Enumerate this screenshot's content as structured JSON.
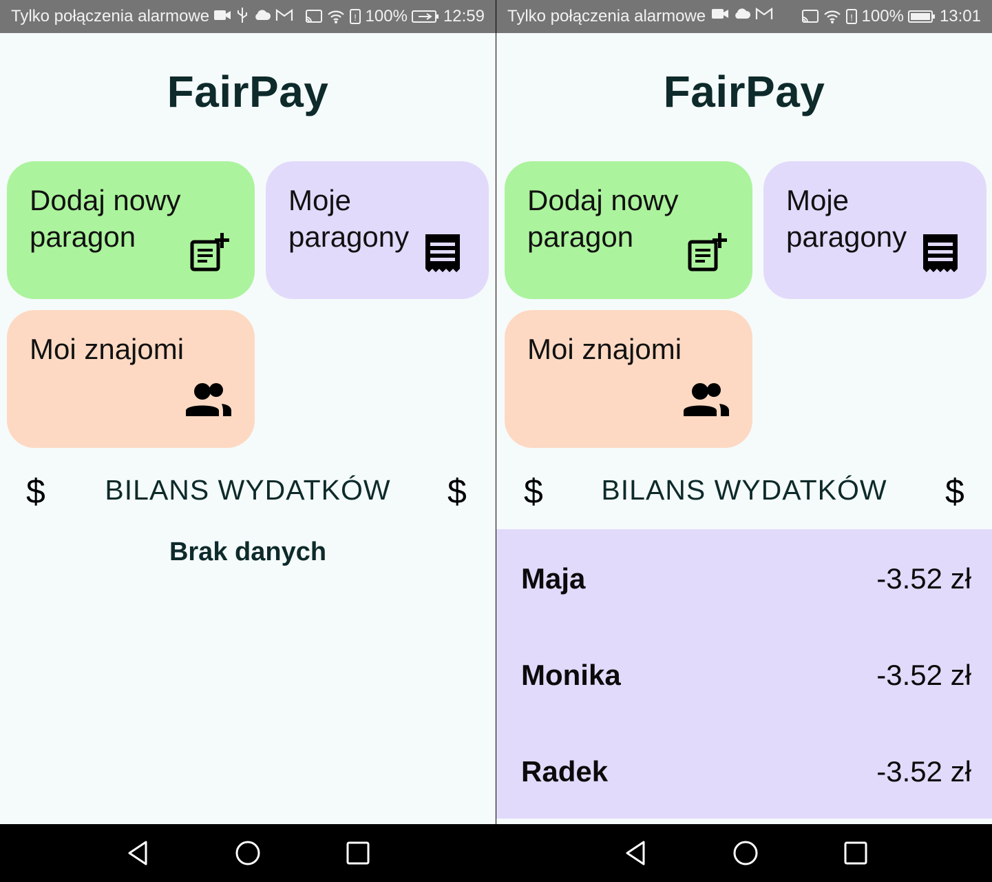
{
  "screens": [
    {
      "status": {
        "carrier": "Tylko połączenia alarmowe",
        "battery": "100%",
        "time": "12:59"
      },
      "app_title": "FairPay",
      "tiles": {
        "add_receipt": "Dodaj nowy paragon",
        "my_receipts": "Moje paragony",
        "my_friends": "Moi znajomi"
      },
      "balance": {
        "title": "BILANS WYDATKÓW",
        "currency_symbol": "$",
        "empty_text": "Brak danych"
      }
    },
    {
      "status": {
        "carrier": "Tylko połączenia alarmowe",
        "battery": "100%",
        "time": "13:01"
      },
      "app_title": "FairPay",
      "tiles": {
        "add_receipt": "Dodaj nowy paragon",
        "my_receipts": "Moje paragony",
        "my_friends": "Moi znajomi"
      },
      "balance": {
        "title": "BILANS WYDATKÓW",
        "currency_symbol": "$",
        "entries": [
          {
            "name": "Maja",
            "amount": "-3.52 zł"
          },
          {
            "name": "Monika",
            "amount": "-3.52 zł"
          },
          {
            "name": "Radek",
            "amount": "-3.52 zł"
          }
        ]
      }
    }
  ],
  "icons": [
    "video-icon",
    "usb-icon",
    "cloud-icon",
    "mail-icon",
    "cast-icon",
    "wifi-icon",
    "sim-icon",
    "battery-icon",
    "add-note-icon",
    "receipt-icon",
    "people-icon",
    "dollar-icon",
    "back-icon",
    "home-icon",
    "recents-icon"
  ],
  "colors": {
    "tile_add": "#acf39d",
    "tile_receipts": "#e2dafb",
    "tile_friends": "#fdd9c3",
    "balance_list": "#e2dafb",
    "title_text": "#0e2a2a",
    "status_bar": "#757575"
  }
}
